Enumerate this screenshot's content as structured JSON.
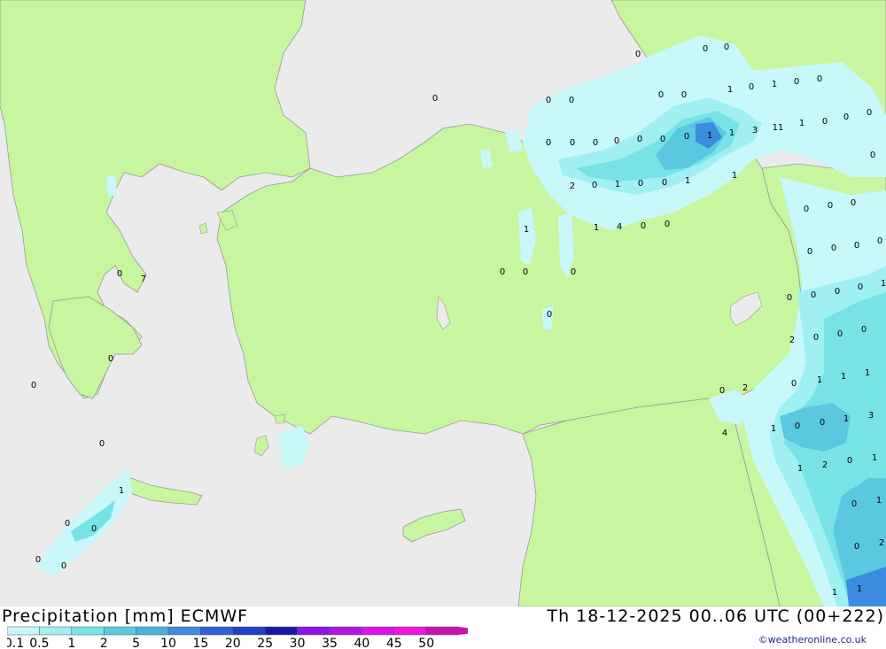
{
  "title": "Precipitation [mm]  ECMWF",
  "datetime": "Th 18-12-2025 00..06 UTC (00+222)",
  "credit": "©weatheronline.co.uk",
  "colors": {
    "sea": "#ebebeb",
    "land": "#c8f5a0",
    "border": "#999999"
  },
  "legend": {
    "labels": [
      "0.1",
      "0.5",
      "1",
      "2",
      "5",
      "10",
      "15",
      "20",
      "25",
      "30",
      "35",
      "40",
      "45",
      "50"
    ],
    "colors": [
      "#c8f8fa",
      "#a0f0f2",
      "#78e3e6",
      "#5ac9e0",
      "#4bafe0",
      "#3c8ce0",
      "#3060dc",
      "#2040c8",
      "#1818a8",
      "#8c14e6",
      "#b414e6",
      "#dc14e6",
      "#f014dc",
      "#c814aa"
    ]
  },
  "point_values": [
    "0",
    "0",
    "0",
    "0",
    "0",
    "0",
    "0",
    "0",
    "1",
    "0",
    "1",
    "0",
    "0",
    "0",
    "0",
    "1",
    "0",
    "0",
    "0",
    "0",
    "0",
    "0",
    "0",
    "0",
    "0",
    "1",
    "1",
    "3",
    "11",
    "2",
    "0",
    "1",
    "0",
    "0",
    "1",
    "1",
    "1",
    "1",
    "4",
    "0",
    "0",
    "0",
    "0",
    "0",
    "0",
    "0",
    "0",
    "0",
    "0",
    "0",
    "0",
    "0",
    "0",
    "0",
    "0",
    "0",
    "1",
    "2",
    "0",
    "0",
    "0",
    "0",
    "2",
    "0",
    "1",
    "1",
    "1",
    "1",
    "0",
    "0",
    "1",
    "3",
    "4",
    "1",
    "2",
    "0",
    "1",
    "0",
    "1",
    "0",
    "2",
    "1",
    "1",
    "0",
    "7",
    "0",
    "0",
    "0",
    "1",
    "0",
    "0",
    "0",
    "0"
  ]
}
